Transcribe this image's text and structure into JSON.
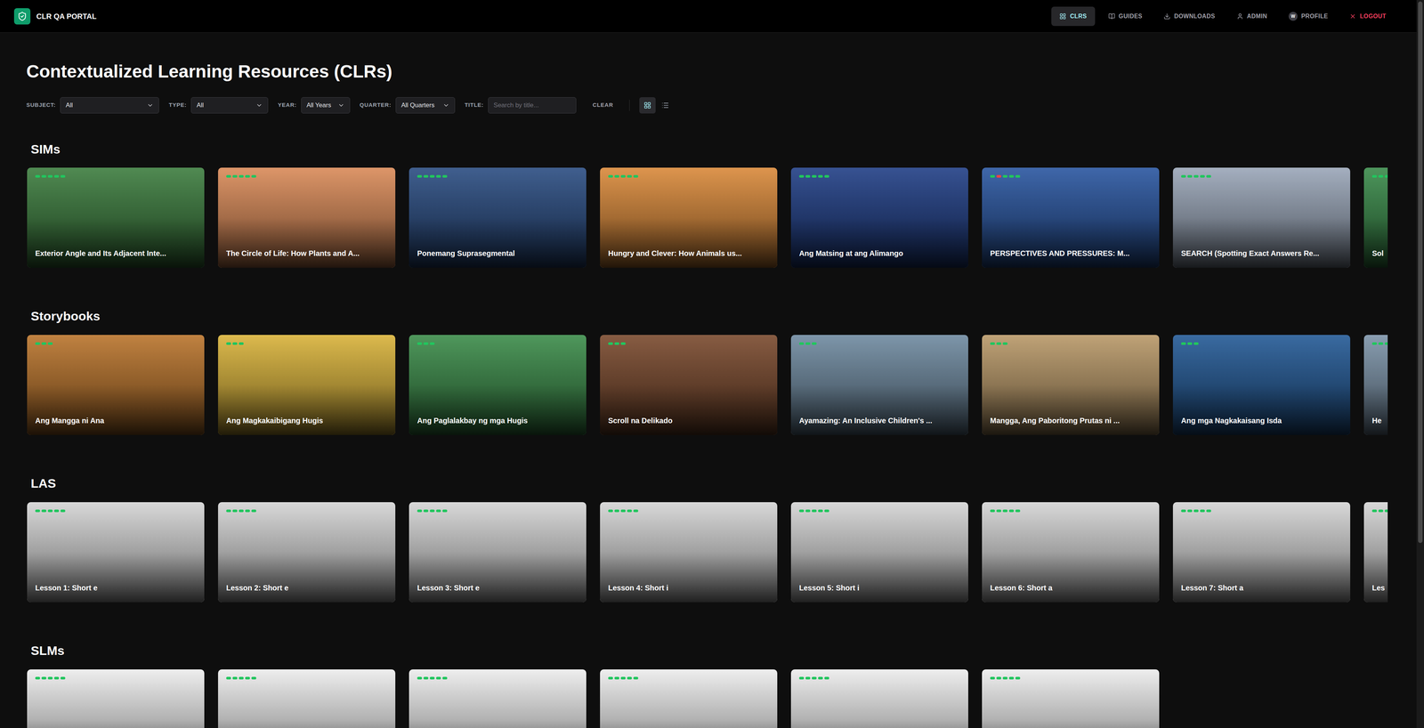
{
  "nav": {
    "brand": "CLR QA PORTAL",
    "items": [
      {
        "label": "CLRS",
        "selected": true,
        "kind": "link"
      },
      {
        "label": "GUIDES",
        "selected": false,
        "kind": "link"
      },
      {
        "label": "DOWNLOADS",
        "selected": false,
        "kind": "link"
      },
      {
        "label": "ADMIN",
        "selected": false,
        "kind": "link"
      },
      {
        "label": "PROFILE",
        "selected": false,
        "kind": "profile",
        "avatar": "W"
      },
      {
        "label": "LOGOUT",
        "selected": false,
        "kind": "danger"
      }
    ]
  },
  "page": {
    "title": "Contextualized Learning Resources (CLRs)"
  },
  "filters": {
    "fields": [
      {
        "label": "SUBJECT:",
        "value": "All",
        "kind": "select"
      },
      {
        "label": "TYPE:",
        "value": "All",
        "kind": "select"
      },
      {
        "label": "YEAR:",
        "value": "All Years",
        "kind": "select"
      },
      {
        "label": "QUARTER:",
        "value": "All Quarters",
        "kind": "select"
      },
      {
        "label": "TITLE:",
        "placeholder": "Search by title...",
        "kind": "input"
      }
    ],
    "clear": "CLEAR",
    "views": [
      {
        "name": "grid",
        "selected": true
      },
      {
        "name": "list",
        "selected": false
      }
    ]
  },
  "sections": [
    {
      "title": "SIMs",
      "cards": [
        {
          "title": "Exterior Angle and Its Adjacent Inte...",
          "color": "#3d7d3f",
          "dots": [
            {
              "color": "#22c55e"
            },
            {
              "color": "#22c55e"
            },
            {
              "color": "#22c55e"
            },
            {
              "color": "#22c55e"
            },
            {
              "color": "#22c55e"
            }
          ]
        },
        {
          "title": "The Circle of Life: How Plants and A...",
          "color": "#d98a58",
          "dots": [
            {
              "color": "#22c55e"
            },
            {
              "color": "#22c55e"
            },
            {
              "color": "#22c55e"
            },
            {
              "color": "#22c55e"
            },
            {
              "color": "#22c55e"
            }
          ]
        },
        {
          "title": "Ponemang Suprasegmental",
          "color": "#2b4d82",
          "dots": [
            {
              "color": "#22c55e"
            },
            {
              "color": "#22c55e"
            },
            {
              "color": "#22c55e"
            },
            {
              "color": "#22c55e"
            },
            {
              "color": "#22c55e"
            }
          ]
        },
        {
          "title": "Hungry and Clever: How Animals us...",
          "color": "#d9893a",
          "dots": [
            {
              "color": "#22c55e"
            },
            {
              "color": "#22c55e"
            },
            {
              "color": "#22c55e"
            },
            {
              "color": "#22c55e"
            },
            {
              "color": "#22c55e"
            }
          ]
        },
        {
          "title": "Ang Matsing at ang Alimango",
          "color": "#213f86",
          "dots": [
            {
              "color": "#22c55e"
            },
            {
              "color": "#22c55e"
            },
            {
              "color": "#22c55e"
            },
            {
              "color": "#22c55e"
            },
            {
              "color": "#22c55e"
            }
          ]
        },
        {
          "title": "PERSPECTIVES AND PRESSURES: M...",
          "color": "#2a56a0",
          "dots": [
            {
              "color": "#22c55e"
            },
            {
              "color": "#ef4444"
            },
            {
              "color": "#22c55e"
            },
            {
              "color": "#22c55e"
            },
            {
              "color": "#22c55e"
            }
          ]
        },
        {
          "title": "SEARCH (Spotting Exact Answers Re...",
          "color": "#9aa6b8",
          "dots": [
            {
              "color": "#22c55e"
            },
            {
              "color": "#22c55e"
            },
            {
              "color": "#22c55e"
            },
            {
              "color": "#22c55e"
            },
            {
              "color": "#22c55e"
            }
          ]
        },
        {
          "title": "Sol",
          "color": "#3a8a4a",
          "dots": [
            {
              "color": "#22c55e"
            },
            {
              "color": "#22c55e"
            },
            {
              "color": "#22c55e"
            },
            {
              "color": "#22c55e"
            },
            {
              "color": "#22c55e"
            }
          ]
        }
      ]
    },
    {
      "title": "Storybooks",
      "cards": [
        {
          "title": "Ang Mangga ni Ana",
          "color": "#b9742c",
          "dots": [
            {
              "color": "#22c55e"
            },
            {
              "color": "#22c55e"
            },
            {
              "color": "#22c55e"
            }
          ]
        },
        {
          "title": "Ang Magkakaibigang Hugis",
          "color": "#d8b23a",
          "dots": [
            {
              "color": "#22c55e"
            },
            {
              "color": "#22c55e"
            },
            {
              "color": "#22c55e"
            }
          ]
        },
        {
          "title": "Ang Paglalakbay ng mga Hugis",
          "color": "#3c8c4a",
          "dots": [
            {
              "color": "#22c55e"
            },
            {
              "color": "#22c55e"
            },
            {
              "color": "#22c55e"
            }
          ]
        },
        {
          "title": "Scroll na Delikado",
          "color": "#7a4a2e",
          "dots": [
            {
              "color": "#22c55e"
            },
            {
              "color": "#22c55e"
            },
            {
              "color": "#22c55e"
            }
          ]
        },
        {
          "title": "Ayamazing: An Inclusive Children's ...",
          "color": "#6f8aa0",
          "dots": [
            {
              "color": "#22c55e"
            },
            {
              "color": "#22c55e"
            },
            {
              "color": "#22c55e"
            }
          ]
        },
        {
          "title": "Mangga, Ang Paboritong Prutas ni ...",
          "color": "#b89868",
          "dots": [
            {
              "color": "#22c55e"
            },
            {
              "color": "#22c55e"
            },
            {
              "color": "#22c55e"
            }
          ]
        },
        {
          "title": "Ang mga Nagkakaisang Isda",
          "color": "#245a96",
          "dots": [
            {
              "color": "#22c55e"
            },
            {
              "color": "#22c55e"
            },
            {
              "color": "#22c55e"
            }
          ]
        },
        {
          "title": "He",
          "color": "#7c93a8",
          "dots": [
            {
              "color": "#22c55e"
            },
            {
              "color": "#22c55e"
            },
            {
              "color": "#22c55e"
            }
          ]
        }
      ]
    },
    {
      "title": "LAS",
      "cards": [
        {
          "title": "Lesson 1: Short e",
          "color": "#d4d4d4",
          "dots": [
            {
              "color": "#22c55e"
            },
            {
              "color": "#22c55e"
            },
            {
              "color": "#22c55e"
            },
            {
              "color": "#22c55e"
            },
            {
              "color": "#22c55e"
            }
          ]
        },
        {
          "title": "Lesson 2: Short e",
          "color": "#d4d4d4",
          "dots": [
            {
              "color": "#22c55e"
            },
            {
              "color": "#22c55e"
            },
            {
              "color": "#22c55e"
            },
            {
              "color": "#22c55e"
            },
            {
              "color": "#22c55e"
            }
          ]
        },
        {
          "title": "Lesson 3: Short e",
          "color": "#d4d4d4",
          "dots": [
            {
              "color": "#22c55e"
            },
            {
              "color": "#22c55e"
            },
            {
              "color": "#22c55e"
            },
            {
              "color": "#22c55e"
            },
            {
              "color": "#22c55e"
            }
          ]
        },
        {
          "title": "Lesson 4: Short i",
          "color": "#d4d4d4",
          "dots": [
            {
              "color": "#22c55e"
            },
            {
              "color": "#22c55e"
            },
            {
              "color": "#22c55e"
            },
            {
              "color": "#22c55e"
            },
            {
              "color": "#22c55e"
            }
          ]
        },
        {
          "title": "Lesson 5: Short i",
          "color": "#d4d4d4",
          "dots": [
            {
              "color": "#22c55e"
            },
            {
              "color": "#22c55e"
            },
            {
              "color": "#22c55e"
            },
            {
              "color": "#22c55e"
            },
            {
              "color": "#22c55e"
            }
          ]
        },
        {
          "title": "Lesson 6: Short a",
          "color": "#d4d4d4",
          "dots": [
            {
              "color": "#22c55e"
            },
            {
              "color": "#22c55e"
            },
            {
              "color": "#22c55e"
            },
            {
              "color": "#22c55e"
            },
            {
              "color": "#22c55e"
            }
          ]
        },
        {
          "title": "Lesson 7: Short a",
          "color": "#d4d4d4",
          "dots": [
            {
              "color": "#22c55e"
            },
            {
              "color": "#22c55e"
            },
            {
              "color": "#22c55e"
            },
            {
              "color": "#22c55e"
            },
            {
              "color": "#22c55e"
            }
          ]
        },
        {
          "title": "Les",
          "color": "#d4d4d4",
          "dots": [
            {
              "color": "#22c55e"
            },
            {
              "color": "#22c55e"
            },
            {
              "color": "#22c55e"
            },
            {
              "color": "#22c55e"
            },
            {
              "color": "#22c55e"
            }
          ]
        }
      ]
    },
    {
      "title": "SLMs",
      "cards": [
        {
          "title": "",
          "color": "#ececec",
          "dots": [
            {
              "color": "#22c55e"
            },
            {
              "color": "#22c55e"
            },
            {
              "color": "#22c55e"
            },
            {
              "color": "#22c55e"
            },
            {
              "color": "#22c55e"
            }
          ]
        },
        {
          "title": "",
          "color": "#ececec",
          "dots": [
            {
              "color": "#22c55e"
            },
            {
              "color": "#22c55e"
            },
            {
              "color": "#22c55e"
            },
            {
              "color": "#22c55e"
            },
            {
              "color": "#22c55e"
            }
          ]
        },
        {
          "title": "",
          "color": "#ececec",
          "dots": [
            {
              "color": "#22c55e"
            },
            {
              "color": "#22c55e"
            },
            {
              "color": "#22c55e"
            },
            {
              "color": "#22c55e"
            },
            {
              "color": "#22c55e"
            }
          ]
        },
        {
          "title": "",
          "color": "#ececec",
          "dots": [
            {
              "color": "#22c55e"
            },
            {
              "color": "#22c55e"
            },
            {
              "color": "#22c55e"
            },
            {
              "color": "#22c55e"
            },
            {
              "color": "#22c55e"
            }
          ]
        },
        {
          "title": "",
          "color": "#ececec",
          "dots": [
            {
              "color": "#22c55e"
            },
            {
              "color": "#22c55e"
            },
            {
              "color": "#22c55e"
            },
            {
              "color": "#22c55e"
            },
            {
              "color": "#22c55e"
            }
          ]
        },
        {
          "title": "",
          "color": "#ececec",
          "dots": [
            {
              "color": "#22c55e"
            },
            {
              "color": "#22c55e"
            },
            {
              "color": "#22c55e"
            },
            {
              "color": "#22c55e"
            },
            {
              "color": "#22c55e"
            }
          ]
        }
      ]
    }
  ]
}
